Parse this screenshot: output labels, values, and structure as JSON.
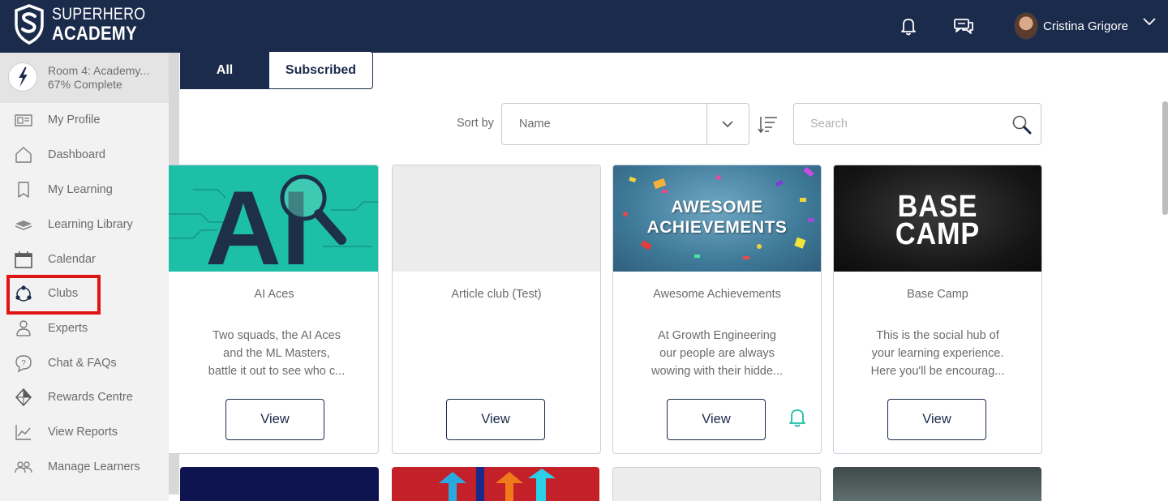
{
  "brand": {
    "line1": "SUPERHERO",
    "line2": "ACADEMY"
  },
  "header": {
    "user_name": "Cristina Grigore",
    "icons": [
      "bell-icon",
      "chat-icon",
      "chevron-down-icon"
    ]
  },
  "sidebar": {
    "room": {
      "title": "Room 4: Academy...",
      "progress": "67% Complete"
    },
    "items": [
      {
        "label": "My Profile",
        "icon": "profile-card-icon"
      },
      {
        "label": "Dashboard",
        "icon": "home-icon"
      },
      {
        "label": "My Learning",
        "icon": "bookmark-icon"
      },
      {
        "label": "Learning Library",
        "icon": "book-icon"
      },
      {
        "label": "Calendar",
        "icon": "calendar-icon"
      },
      {
        "label": "Clubs",
        "icon": "clubs-icon"
      },
      {
        "label": "Experts",
        "icon": "expert-icon"
      },
      {
        "label": "Chat & FAQs",
        "icon": "question-bubble-icon"
      },
      {
        "label": "Rewards Centre",
        "icon": "diamond-icon"
      },
      {
        "label": "View Reports",
        "icon": "line-chart-icon"
      },
      {
        "label": "Manage Learners",
        "icon": "people-icon"
      }
    ],
    "highlight_color": "#e11414"
  },
  "filters": {
    "tab_all": "All",
    "tab_subscribed": "Subscribed",
    "active": "All"
  },
  "sort": {
    "label": "Sort by",
    "value": "Name"
  },
  "search": {
    "placeholder": "Search"
  },
  "cards": [
    {
      "image_text": "AI",
      "title": "AI Aces",
      "desc_lines": [
        "Two squads, the AI Aces",
        "and the ML Masters,",
        "battle it out to see who c..."
      ],
      "button": "View"
    },
    {
      "image_text": "",
      "title": "Article club (Test)",
      "desc_lines": [],
      "button": "View"
    },
    {
      "image_line1": "AWESOME",
      "image_line2": "ACHIEVEMENTS",
      "title": "Awesome Achievements",
      "desc_lines": [
        "At Growth Engineering",
        "our people are always",
        "wowing with their hidde..."
      ],
      "button": "View",
      "subscribed": true
    },
    {
      "image_line1": "BASE",
      "image_line2": "CAMP",
      "title": "Base Camp",
      "desc_lines": [
        "This is the social hub of",
        "your learning experience.",
        "Here you'll be encourag..."
      ],
      "button": "View"
    }
  ],
  "colors": {
    "navy": "#1b2b4b",
    "accent_teal": "#1bbfa5"
  }
}
